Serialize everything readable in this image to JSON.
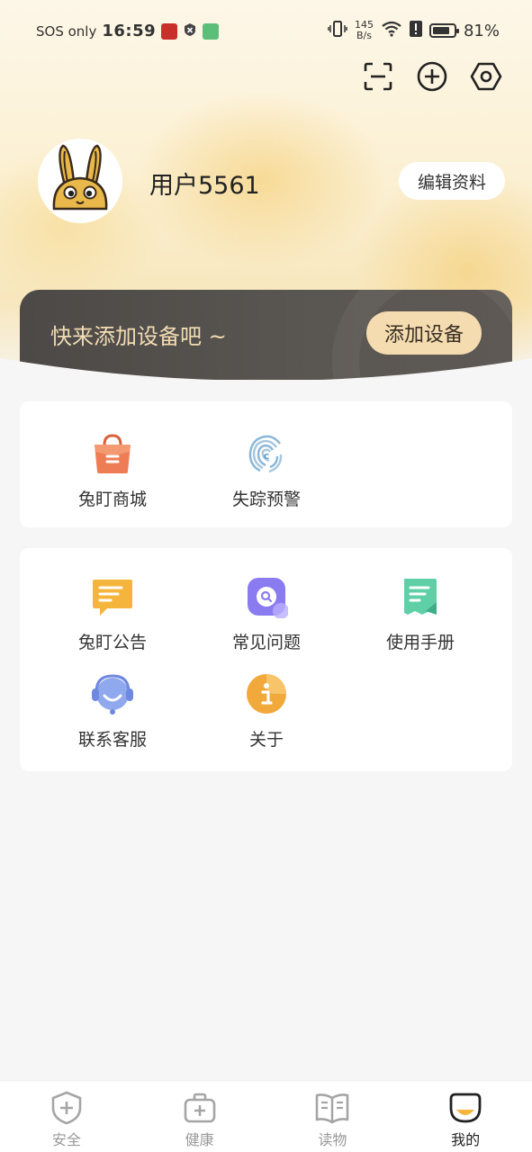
{
  "status_bar": {
    "network_text": "SOS only",
    "time": "16:59",
    "speed_value": "145",
    "speed_unit": "B/s",
    "battery_percent": "81%",
    "battery_level": 0.81
  },
  "top_actions": [
    {
      "icon": "scan-icon"
    },
    {
      "icon": "add-circle-icon"
    },
    {
      "icon": "settings-hex-icon"
    }
  ],
  "profile": {
    "username": "用户5561",
    "edit_label": "编辑资料"
  },
  "device_banner": {
    "prompt": "快来添加设备吧 ~",
    "add_button": "添加设备"
  },
  "services": [
    {
      "label": "兔盯商城",
      "icon": "shopping-bag-icon"
    },
    {
      "label": "失踪预警",
      "icon": "fingerprint-icon"
    }
  ],
  "support": [
    {
      "label": "兔盯公告",
      "icon": "announcement-icon"
    },
    {
      "label": "常见问题",
      "icon": "faq-icon"
    },
    {
      "label": "使用手册",
      "icon": "manual-icon"
    },
    {
      "label": "联系客服",
      "icon": "customer-service-icon"
    },
    {
      "label": "关于",
      "icon": "info-icon"
    }
  ],
  "tabs": [
    {
      "label": "安全",
      "icon": "shield-icon",
      "active": false
    },
    {
      "label": "健康",
      "icon": "medical-kit-icon",
      "active": false
    },
    {
      "label": "读物",
      "icon": "book-icon",
      "active": false
    },
    {
      "label": "我的",
      "icon": "profile-tab-icon",
      "active": true
    }
  ],
  "colors": {
    "banner_bg": "#4c4946",
    "banner_text": "#f3dcb4",
    "add_button_bg": "#f4dcb0",
    "shop_orange": "#ee7d55",
    "faq_purple": "#8a7cf0",
    "manual_green": "#5fcfa8",
    "notice_yellow": "#f5b53c",
    "info_orange": "#f2a93b"
  }
}
